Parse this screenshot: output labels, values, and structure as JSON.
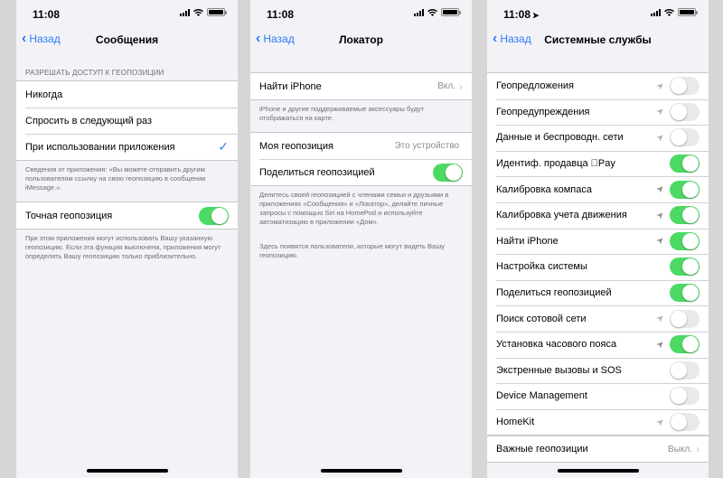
{
  "phone1": {
    "time": "11:08",
    "back": "Назад",
    "title": "Сообщения",
    "section_header": "РАЗРЕШАТЬ ДОСТУП К ГЕОПОЗИЦИИ",
    "options": [
      {
        "label": "Никогда",
        "checked": false
      },
      {
        "label": "Спросить в следующий раз",
        "checked": false
      },
      {
        "label": "При использовании приложения",
        "checked": true
      }
    ],
    "app_note": "Сведения от приложения: «Вы можете отправить другим пользователям ссылку на свою геопозицию в сообщении iMessage.».",
    "precise_label": "Точная геопозиция",
    "precise_on": true,
    "precise_note": "При этом приложения могут использовать Вашу указанную геопозицию. Если эта функция выключена, приложения могут определять Вашу геопозицию только приблизительно."
  },
  "phone2": {
    "time": "11:08",
    "back": "Назад",
    "title": "Локатор",
    "find_iphone_label": "Найти iPhone",
    "find_iphone_value": "Вкл.",
    "find_note": "iPhone и другие поддерживаемые аксессуары будут отображаться на карте.",
    "my_location_label": "Моя геопозиция",
    "my_location_value": "Это устройство",
    "share_label": "Поделиться геопозицией",
    "share_on": true,
    "share_note": "Делитесь своей геопозицией с членами семьи и друзьями в приложениях «Сообщения» и «Локатор», делайте личные запросы с помощью Siri на HomePod и используйте автоматизацию в приложении «Дом».",
    "people_note": "Здесь появятся пользователи, которые могут видеть Вашу геопозицию."
  },
  "phone3": {
    "time": "11:08",
    "back": "Назад",
    "title": "Системные службы",
    "rows": [
      {
        "label": "Геопредложения",
        "arrow": true,
        "on": false
      },
      {
        "label": "Геопредупреждения",
        "arrow": true,
        "on": false
      },
      {
        "label": "Данные и беспроводн. сети",
        "arrow": true,
        "on": false
      },
      {
        "label": "Идентиф. продавца Pay",
        "arrow": false,
        "on": true
      },
      {
        "label": "Калибровка компаса",
        "arrow": true,
        "on": true
      },
      {
        "label": "Калибровка учета движения",
        "arrow": true,
        "on": true
      },
      {
        "label": "Найти iPhone",
        "arrow": true,
        "on": true
      },
      {
        "label": "Настройка системы",
        "arrow": false,
        "on": true
      },
      {
        "label": "Поделиться геопозицией",
        "arrow": false,
        "on": true
      },
      {
        "label": "Поиск сотовой сети",
        "arrow": true,
        "on": false
      },
      {
        "label": "Установка часового пояса",
        "arrow": true,
        "on": true
      },
      {
        "label": "Экстренные вызовы и SOS",
        "arrow": false,
        "on": false
      },
      {
        "label": "Device Management",
        "arrow": false,
        "on": false
      },
      {
        "label": "HomeKit",
        "arrow": true,
        "on": false
      }
    ],
    "important_label": "Важные геопозиции",
    "important_value": "Выкл."
  },
  "icons": {
    "back": "chevron-left-icon",
    "location": "location-arrow-icon",
    "check": "checkmark-icon"
  },
  "colors": {
    "accent": "#2f7cf6",
    "toggle_on": "#4cd964",
    "toggle_off": "#e9e9eb",
    "background": "#f2f2f7"
  }
}
